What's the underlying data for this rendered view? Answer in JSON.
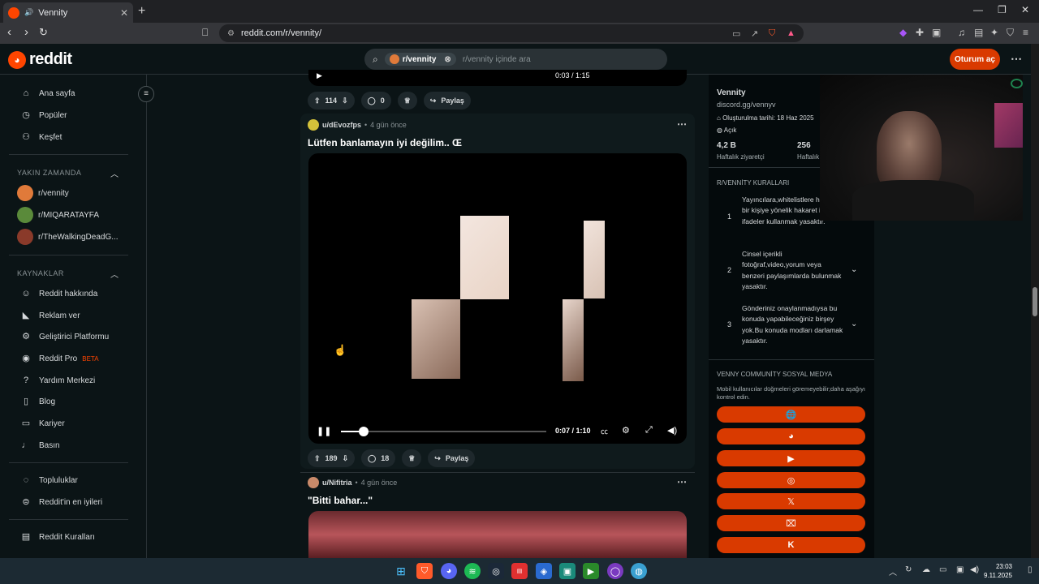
{
  "browser": {
    "tab_title": "Vennity",
    "url": "reddit.com/r/vennity/"
  },
  "header": {
    "logo_text": "reddit",
    "search_chip": "r/vennity",
    "search_placeholder": "r/vennity içinde ara",
    "login_label": "Oturum aç"
  },
  "sidebar": {
    "main": [
      {
        "label": "Ana sayfa",
        "icon": "home-icon"
      },
      {
        "label": "Popüler",
        "icon": "popular-icon"
      },
      {
        "label": "Keşfet",
        "icon": "explore-icon"
      }
    ],
    "recent_heading": "YAKIN ZAMANDA",
    "recent": [
      {
        "label": "r/vennity",
        "color": "#e07a3a"
      },
      {
        "label": "r/MIQARATAYFA",
        "color": "#5a8a3a"
      },
      {
        "label": "r/TheWalkingDeadG...",
        "color": "#8a3a2a"
      }
    ],
    "resources_heading": "KAYNAKLAR",
    "resources": [
      {
        "label": "Reddit hakkında"
      },
      {
        "label": "Reklam ver"
      },
      {
        "label": "Geliştirici Platformu"
      },
      {
        "label": "Reddit Pro",
        "badge": "BETA"
      },
      {
        "label": "Yardım Merkezi"
      },
      {
        "label": "Blog"
      },
      {
        "label": "Kariyer"
      },
      {
        "label": "Basın"
      }
    ],
    "communities": [
      {
        "label": "Topluluklar"
      },
      {
        "label": "Reddit'in en iyileri"
      }
    ],
    "rules_label": "Reddit Kuralları"
  },
  "posts": [
    {
      "votes": "114",
      "comments": "0",
      "share": "Paylaş",
      "time_readout": "0:03 / 1:15"
    },
    {
      "user": "u/dEvozfps",
      "time": "4 gün önce",
      "title": "Lütfen banlamayın iyi değilim.. Œ",
      "votes": "189",
      "comments": "18",
      "share": "Paylaş",
      "time_readout": "0:07 / 1:10",
      "progress": 0.11
    },
    {
      "user": "u/Nifitria",
      "time": "4 gün önce",
      "title": "\"Bitti bahar...\""
    }
  ],
  "community": {
    "name": "Vennity",
    "link": "discord.gg/vennyv",
    "created": "Oluşturulma tarihi: 18 Haz 2025",
    "status": "Açık",
    "visitors_value": "4,2 B",
    "visitors_label": "Haftalık ziyaretçi",
    "contrib_value": "256",
    "contrib_label": "Haftalık",
    "rules_heading": "R/VENNİTY KURALLARI",
    "rules": [
      {
        "num": "1",
        "text": "Yayıncılara,whitelistlere herhangi bir kişiye yönelik hakaret içeren ifadeler kullanmak yasaktır."
      },
      {
        "num": "2",
        "text": "Cinsel içerikli fotoğraf,video,yorum veya benzeri paylaşımlarda bulunmak yasaktır."
      },
      {
        "num": "3",
        "text": "Gönderiniz onaylanmadıysa bu konuda yapabileceğiniz birşey yok.Bu konuda modları darlamak yasaktır."
      }
    ],
    "social_heading": "VENNY COMMUNİTY SOSYAL MEDYA",
    "social_note": "Mobil kullanıcılar düğmeleri göremeyebilir;daha aşağıyı kontrol edin.",
    "social_buttons": [
      {
        "icon": "globe-icon",
        "glyph": "🌐"
      },
      {
        "icon": "discord-icon",
        "glyph": "◕"
      },
      {
        "icon": "youtube-icon",
        "glyph": "▶"
      },
      {
        "icon": "instagram-icon",
        "glyph": "◎"
      },
      {
        "icon": "x-icon",
        "glyph": "𝕏"
      },
      {
        "icon": "twitch-icon",
        "glyph": "⌧"
      },
      {
        "icon": "kick-icon",
        "glyph": "K"
      }
    ]
  },
  "taskbar": {
    "time": "23:03",
    "date": "9.11.2025"
  }
}
